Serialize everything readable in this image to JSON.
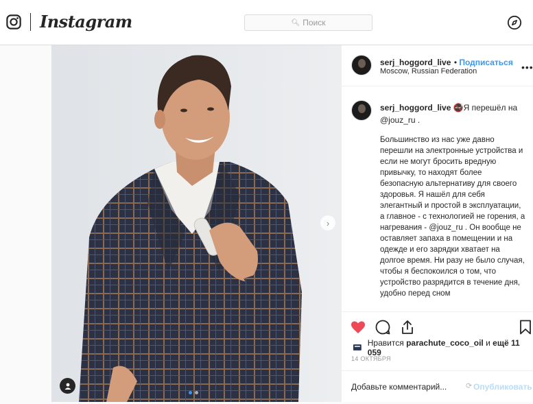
{
  "header": {
    "wordmark": "Instagram",
    "search_placeholder": "Поиск"
  },
  "post": {
    "username": "serj_hoggord_live",
    "follow_label": "Подписаться",
    "location": "Moscow, Russian Federation",
    "caption_first": "🚭Я перешёл на @jouz_ru .",
    "caption_body": "Большинство из нас уже давно перешли на электронные устройства и если не могут бросить вредную привычку, то находят более безопасную альтернативу для своего здоровья. Я нашёл для себя элегантный и простой в эксплуатации, а главное - с технологией не горения, а нагревания - @jouz_ru . Он вообще не оставляет запаха в помещении и на одежде и его зарядки хватает на долгое время. Ни разу не было случая, чтобы я беспокоился о том, что устройство разрядится в течение дня, удобно перед сном",
    "likes_prefix": "Нравится",
    "likes_user": "parachute_coco_oil",
    "likes_conj": "и",
    "likes_count": "ещё 11 059",
    "date": "14 ОКТЯБРЯ",
    "comment_placeholder": "Добавьте комментарий...",
    "publish_label": "Опубликовать",
    "liked": true,
    "carousel_index": 1,
    "carousel_total": 2
  },
  "colors": {
    "accent": "#3897f0",
    "like": "#ed4956",
    "text": "#262626"
  }
}
